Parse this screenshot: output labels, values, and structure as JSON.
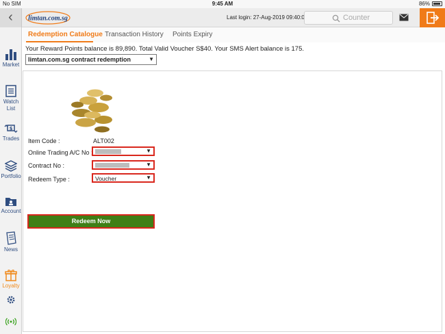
{
  "status_bar": {
    "carrier": "No SIM",
    "time": "9:45 AM",
    "battery": "86%"
  },
  "header": {
    "logo_text": "limtan.com.sg",
    "last_login": "Last login: 27-Aug-2019 09:40:08",
    "search_placeholder": "Counter"
  },
  "sidebar": {
    "items": [
      {
        "label": "Market",
        "icon": "bar-chart-icon"
      },
      {
        "label": "Watch List",
        "icon": "list-icon"
      },
      {
        "label": "Trades",
        "icon": "trades-icon"
      },
      {
        "label": "Portfolio",
        "icon": "layers-icon"
      },
      {
        "label": "Account",
        "icon": "folder-icon"
      },
      {
        "label": "News",
        "icon": "news-icon"
      },
      {
        "label": "Loyalty",
        "icon": "gift-icon"
      }
    ]
  },
  "tabs": [
    {
      "label": "Redemption Catalogue",
      "active": true
    },
    {
      "label": "Transaction History",
      "active": false
    },
    {
      "label": "Points Expiry",
      "active": false
    }
  ],
  "balance_text": "Your Reward Points balance is 89,890. Total Valid Voucher S$40. Your SMS Alert balance is 175.",
  "catalogue_select": "limtan.com.sg contract redemption",
  "form": {
    "item_code_label": "Item Code :",
    "item_code_value": "ALT002",
    "account_label": "Online Trading A/C No :",
    "contract_label": "Contract No :",
    "redeem_type_label": "Redeem Type :",
    "redeem_type_value": "Voucher",
    "redeem_button": "Redeem Now"
  },
  "colors": {
    "accent": "#f07b18",
    "nav": "#2f4d80",
    "button": "#3f7f16",
    "highlight": "#d9261c"
  }
}
